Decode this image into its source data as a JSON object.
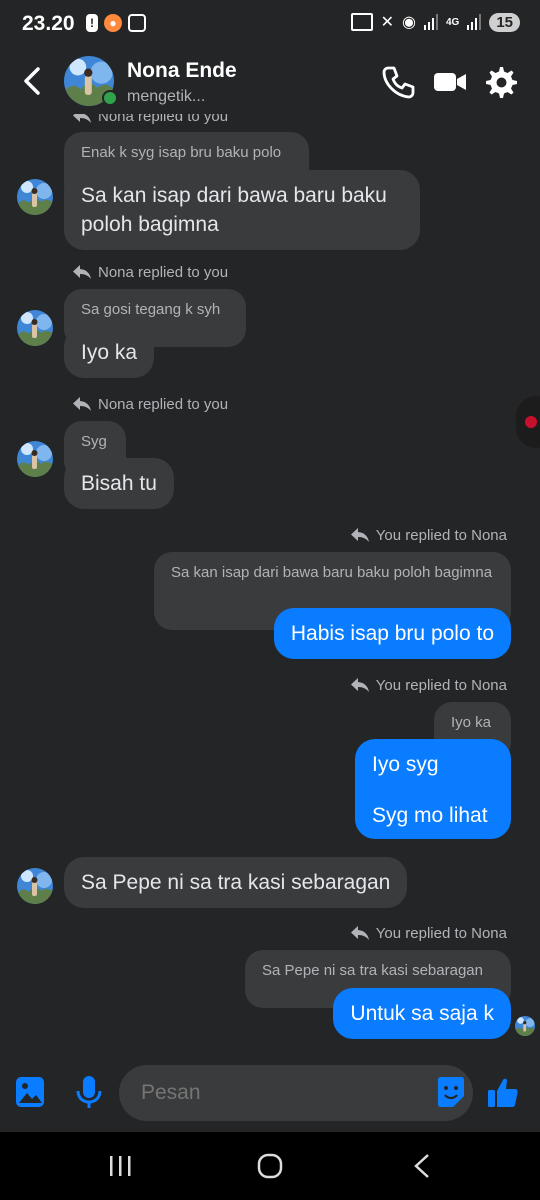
{
  "status_bar": {
    "time": "23.20",
    "network": "4G",
    "battery": "15"
  },
  "header": {
    "contact_name": "Nona Ende",
    "status": "mengetik..."
  },
  "messages": [
    {
      "meta": "Nona replied to you",
      "quote": "Enak k syg isap bru baku polo",
      "text": "Sa kan isap dari bawa baru baku poloh bagimna"
    },
    {
      "meta": "Nona replied to you",
      "quote": "Sa gosi tegang k syh",
      "text": "Iyo ka"
    },
    {
      "meta": "Nona replied to you",
      "quote": "Syg",
      "text": "Bisah tu"
    },
    {
      "meta": "You replied to Nona",
      "quote": "Sa kan isap dari bawa baru  baku poloh bagimna",
      "text": "Habis isap bru polo to"
    },
    {
      "meta": "You replied to Nona",
      "quote": "Iyo ka",
      "text": "Iyo syg",
      "text2": "Syg mo lihat"
    },
    {
      "text": "Sa Pepe ni sa tra kasi sebaragan"
    },
    {
      "meta": "You replied to Nona",
      "quote": "Sa Pepe ni sa tra kasi sebaragan",
      "text": "Untuk sa saja k"
    }
  ],
  "composer": {
    "placeholder": "Pesan"
  },
  "colors": {
    "background": "#242526",
    "bubble_in": "#3a3b3c",
    "bubble_out": "#0a7cff",
    "online": "#31a24c"
  }
}
